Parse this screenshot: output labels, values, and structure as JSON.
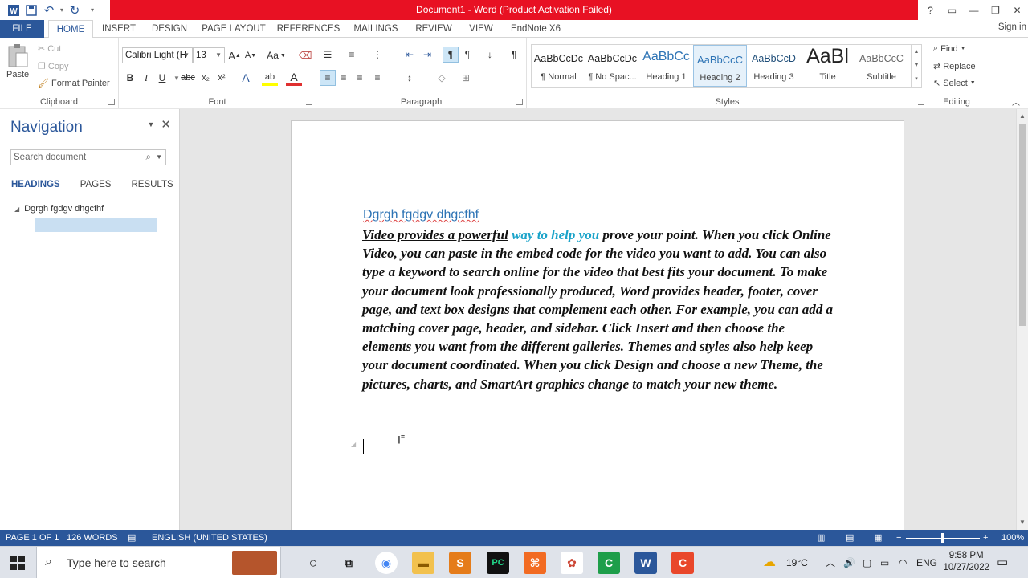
{
  "titlebar": {
    "title": "Document1 - Word (Product Activation Failed)",
    "controls": [
      "?",
      "▭",
      "—",
      "❐",
      "✕"
    ]
  },
  "tabs": {
    "file": "FILE",
    "items": [
      "HOME",
      "INSERT",
      "DESIGN",
      "PAGE LAYOUT",
      "REFERENCES",
      "MAILINGS",
      "REVIEW",
      "VIEW",
      "EndNote X6"
    ],
    "signin": "Sign in"
  },
  "clipboard": {
    "label": "Clipboard",
    "paste": "Paste",
    "cut": "Cut",
    "copy": "Copy",
    "format_painter": "Format Painter"
  },
  "font": {
    "label": "Font",
    "name": "Calibri Light (H",
    "size": "13",
    "bold": "B",
    "italic": "I",
    "underline": "U",
    "strike": "abc",
    "sub": "x₂",
    "sup": "x²",
    "grow": "A",
    "shrink": "A",
    "case": "Aa",
    "text_effects": "A",
    "highlight": "ab",
    "font_color": "A"
  },
  "paragraph": {
    "label": "Paragraph"
  },
  "styles": {
    "label": "Styles",
    "items": [
      {
        "preview": "AaBbCcDc",
        "name": "¶ Normal"
      },
      {
        "preview": "AaBbCcDc",
        "name": "¶ No Spac..."
      },
      {
        "preview": "AaBbCc",
        "name": "Heading 1"
      },
      {
        "preview": "AaBbCcC",
        "name": "Heading 2"
      },
      {
        "preview": "AaBbCcD",
        "name": "Heading 3"
      },
      {
        "preview": "AaBl",
        "name": "Title"
      },
      {
        "preview": "AaBbCcC",
        "name": "Subtitle"
      }
    ]
  },
  "editing": {
    "label": "Editing",
    "find": "Find",
    "replace": "Replace",
    "select": "Select"
  },
  "nav": {
    "title": "Navigation",
    "search_placeholder": "Search document",
    "tabs": [
      "HEADINGS",
      "PAGES",
      "RESULTS"
    ],
    "heading": "Dgrgh  fgdgv dhgcfhf"
  },
  "document": {
    "heading": "Dgrgh  fgdgv dhgcfhf",
    "underlined": "Video provides a powerful",
    "colored": "way to help you",
    "rest": "prove your point. When you click Online Video, you can paste in the embed code for the video you want to add. You can also type a keyword to search online for the video that best fits your document. To make your document look professionally produced, Word provides header, footer, cover page, and text box designs that complement each other. For example, you can add a matching cover page, header, and sidebar. Click Insert and then choose the elements you want from the different galleries. Themes and styles also help keep your document coordinated. When you click Design and choose a new Theme, the pictures, charts, and SmartArt graphics change to match your new theme."
  },
  "statusbar": {
    "page": "PAGE 1 OF 1",
    "words": "126 WORDS",
    "language": "ENGLISH (UNITED STATES)",
    "zoom": "100%"
  },
  "taskbar": {
    "search": "Type here to search",
    "temp": "19°C",
    "lang": "ENG",
    "time": "9:58 PM",
    "date": "10/27/2022"
  },
  "colors": {
    "word_blue": "#2b579a",
    "title_red": "#e81123",
    "heading_blue": "#2e74b5",
    "teal_text": "#1aa3c9"
  }
}
